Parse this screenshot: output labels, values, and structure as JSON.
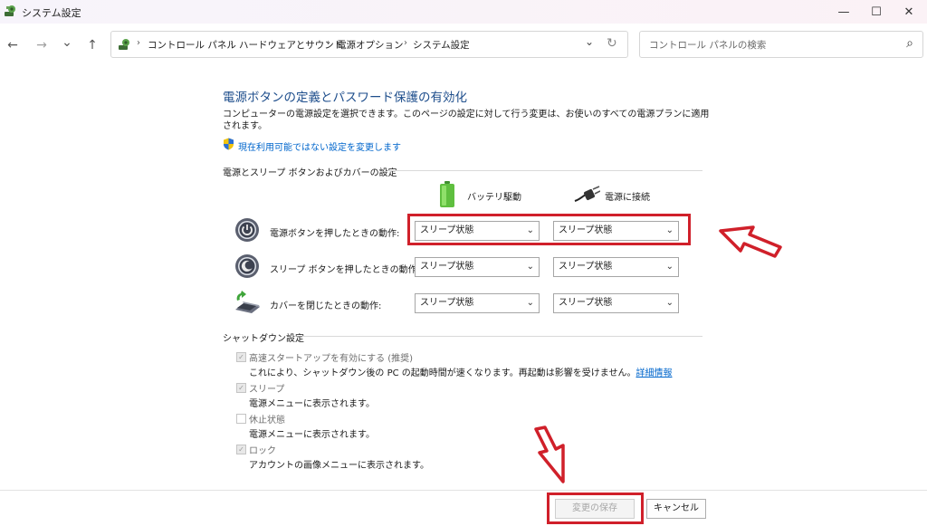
{
  "window": {
    "title": "システム設定",
    "minimize": "—",
    "maximize": "☐",
    "close": "✕"
  },
  "nav": {
    "back": "←",
    "forward": "→",
    "recent": "⌄",
    "up": "↑"
  },
  "breadcrumb": {
    "items": [
      "コントロール パネル",
      "ハードウェアとサウンド",
      "電源オプション",
      "システム設定"
    ],
    "separator": "›",
    "dropdown": "⌄",
    "refresh": "↻"
  },
  "search": {
    "placeholder": "コントロール パネルの検索",
    "icon": "⌕"
  },
  "page": {
    "title": "電源ボタンの定義とパスワード保護の有効化",
    "description": "コンピューターの電源設定を選択できます。このページの設定に対して行う変更は、お使いのすべての電源プランに適用されます。",
    "admin_link": "現在利用可能ではない設定を変更します"
  },
  "power_section": {
    "label": "電源とスリープ ボタンおよびカバーの設定",
    "col_battery": "バッテリ駆動",
    "col_plugged": "電源に接続",
    "rows": [
      {
        "label": "電源ボタンを押したときの動作:",
        "battery": "スリープ状態",
        "plugged": "スリープ状態"
      },
      {
        "label": "スリープ ボタンを押したときの動作:",
        "battery": "スリープ状態",
        "plugged": "スリープ状態"
      },
      {
        "label": "カバーを閉じたときの動作:",
        "battery": "スリープ状態",
        "plugged": "スリープ状態"
      }
    ]
  },
  "shutdown_section": {
    "label": "シャットダウン設定",
    "items": [
      {
        "label": "高速スタートアップを有効にする (推奨)",
        "desc": "これにより、シャットダウン後の PC の起動時間が速くなります。再起動は影響を受けません。",
        "link": "詳細情報",
        "checked": true
      },
      {
        "label": "スリープ",
        "desc": "電源メニューに表示されます。",
        "checked": true
      },
      {
        "label": "休止状態",
        "desc": "電源メニューに表示されます。",
        "checked": false
      },
      {
        "label": "ロック",
        "desc": "アカウントの画像メニューに表示されます。",
        "checked": true
      }
    ]
  },
  "footer": {
    "save": "変更の保存",
    "cancel": "キャンセル"
  },
  "colors": {
    "accent_title": "#1e4e8c",
    "link": "#0066cc",
    "highlight_red": "#d0202a"
  },
  "icons": {
    "app": "control-panel-icon",
    "admin": "uac-shield-icon",
    "battery": "battery-icon",
    "plug": "power-plug-icon",
    "power_button": "power-button-icon",
    "sleep_button": "sleep-button-icon",
    "lid": "laptop-lid-icon"
  }
}
